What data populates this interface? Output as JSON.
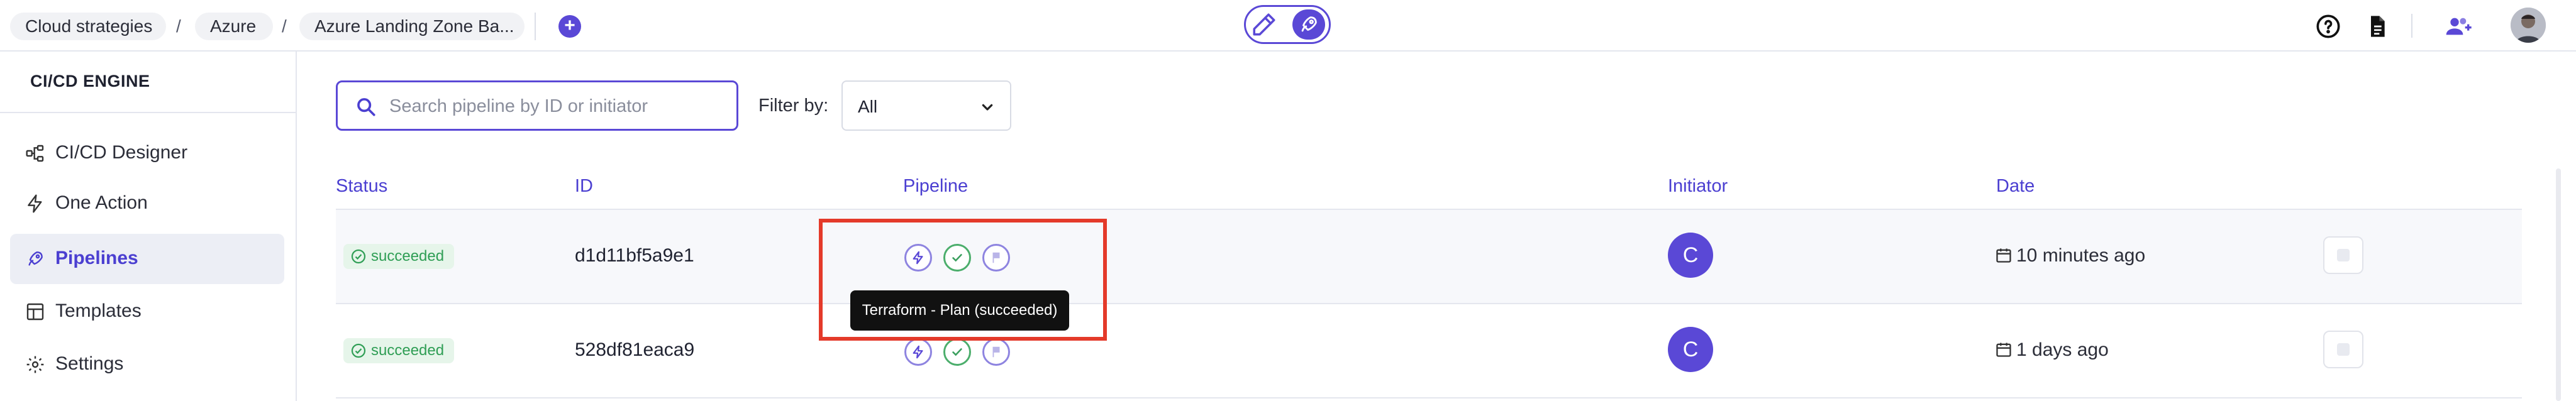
{
  "breadcrumb": [
    {
      "label": "Cloud strategies"
    },
    {
      "label": "Azure"
    },
    {
      "label": "Azure Landing Zone Ba..."
    }
  ],
  "breadcrumb_separator": "/",
  "add_button_label": "+",
  "colors": {
    "accent": "#5a48d6",
    "accent_text": "#4b3fd1",
    "success": "#2f9e55",
    "highlight": "#e43a2a"
  },
  "sidebar": {
    "title": "CI/CD ENGINE",
    "items": [
      {
        "label": "CI/CD Designer",
        "icon": "designer-icon",
        "active": false
      },
      {
        "label": "One Action",
        "icon": "bolt-icon",
        "active": false
      },
      {
        "label": "Pipelines",
        "icon": "rocket-icon",
        "active": true
      },
      {
        "label": "Templates",
        "icon": "layout-icon",
        "active": false
      },
      {
        "label": "Settings",
        "icon": "gear-icon",
        "active": false
      }
    ]
  },
  "search": {
    "placeholder": "Search pipeline by ID or initiator",
    "value": ""
  },
  "filter": {
    "label": "Filter by:",
    "value": "All"
  },
  "table": {
    "columns": [
      "Status",
      "ID",
      "Pipeline",
      "Initiator",
      "Date"
    ],
    "rows": [
      {
        "status": "succeeded",
        "id": "d1d11bf5a9e1",
        "initiator": "C",
        "date": "10 minutes ago"
      },
      {
        "status": "succeeded",
        "id": "528df81eaca9",
        "initiator": "C",
        "date": "1 days ago"
      }
    ]
  },
  "tooltip": "Terraform - Plan (succeeded)"
}
